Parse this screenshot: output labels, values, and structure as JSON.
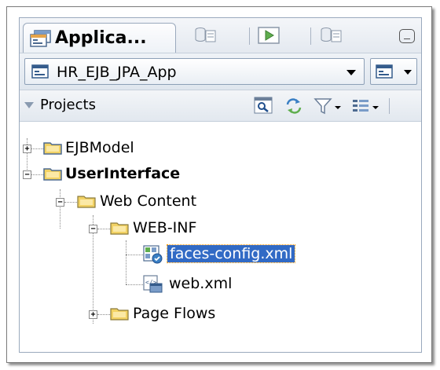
{
  "tabs": {
    "active_label": "Applica...",
    "others": [
      {
        "icon": "database-icon"
      },
      {
        "icon": "run-icon"
      },
      {
        "icon": "database-icon"
      }
    ]
  },
  "app_selector": {
    "value": "HR_EJB_JPA_App"
  },
  "projects": {
    "label": "Projects",
    "toolbar_icons": [
      "search-icon",
      "refresh-icon",
      "filter-icon",
      "layout-icon"
    ]
  },
  "tree": [
    {
      "label": "EJBModel",
      "bold": false,
      "selected": false,
      "expanded": false,
      "icon": "folder"
    },
    {
      "label": "UserInterface",
      "bold": true,
      "selected": false,
      "expanded": true,
      "icon": "folder"
    },
    {
      "label": "Web Content",
      "bold": false,
      "selected": false,
      "expanded": true,
      "icon": "folder"
    },
    {
      "label": "WEB-INF",
      "bold": false,
      "selected": false,
      "expanded": true,
      "icon": "folder"
    },
    {
      "label": "faces-config.xml",
      "bold": false,
      "selected": true,
      "icon": "faces-config-file"
    },
    {
      "label": "web.xml",
      "bold": false,
      "selected": false,
      "icon": "xml-file"
    },
    {
      "label": "Page Flows",
      "bold": false,
      "selected": false,
      "expanded": false,
      "icon": "folder"
    }
  ],
  "colors": {
    "selection": "#316ac5",
    "folder": "#f2d264",
    "panel_border": "#9aa9bd"
  }
}
